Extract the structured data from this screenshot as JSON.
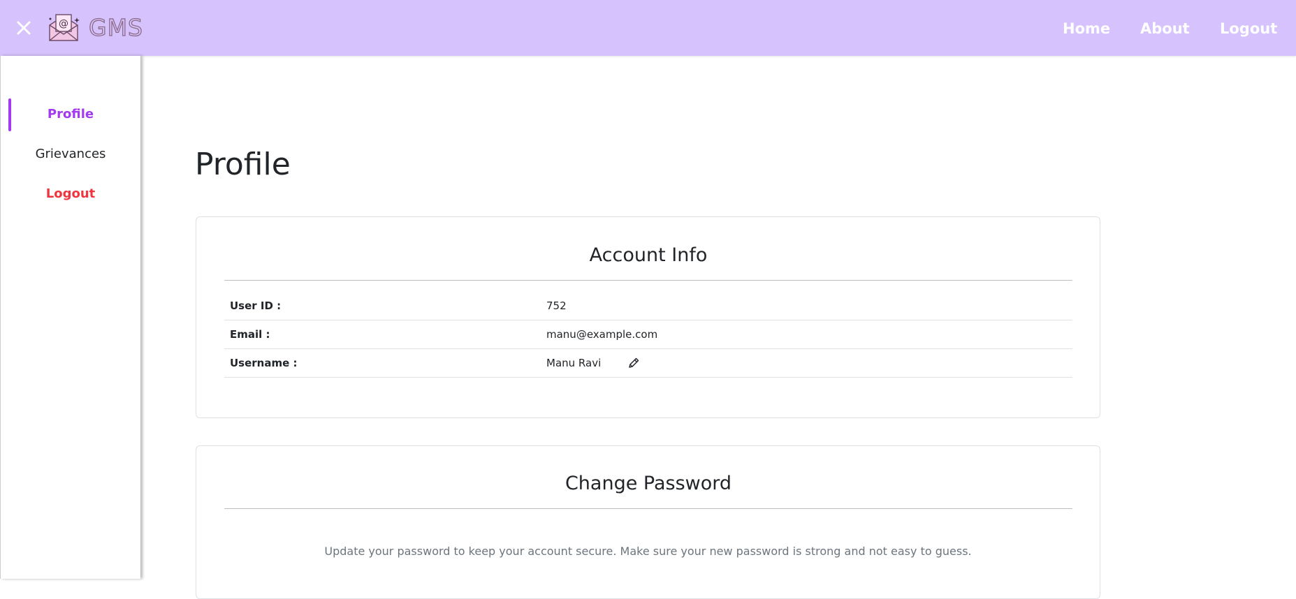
{
  "header": {
    "brand": "GMS",
    "nav": {
      "home": "Home",
      "about": "About",
      "logout": "Logout"
    }
  },
  "sidebar": {
    "items": [
      {
        "label": "Profile",
        "color": "#a339f0",
        "active": true
      },
      {
        "label": "Grievances",
        "color": "#212529",
        "active": false
      },
      {
        "label": "Logout",
        "color": "#f0353f",
        "active": false
      }
    ]
  },
  "main": {
    "title": "Profile",
    "account_info": {
      "title": "Account Info",
      "rows": [
        {
          "label": "User ID :",
          "value": "752"
        },
        {
          "label": "Email :",
          "value": "manu@example.com"
        },
        {
          "label": "Username :",
          "value": "Manu Ravi"
        }
      ]
    },
    "change_password": {
      "title": "Change Password",
      "description": "Update your password to keep your account secure. Make sure your new password is strong and not easy to guess."
    }
  },
  "colors": {
    "topbar": "#d6c2fd",
    "accent": "#a339f0",
    "danger": "#f0353f"
  }
}
